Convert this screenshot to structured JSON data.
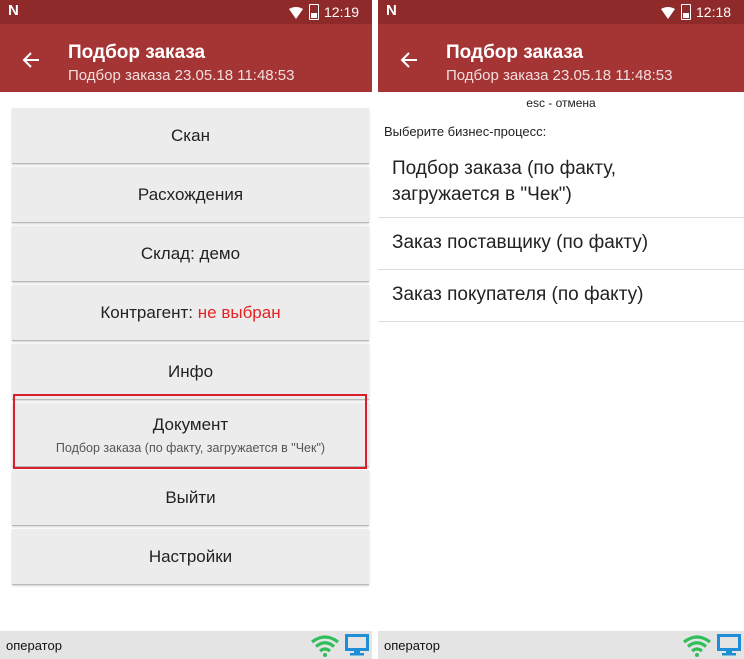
{
  "left": {
    "status_bar": {
      "time": "12:19"
    },
    "header": {
      "title": "Подбор заказа",
      "subtitle": "Подбор заказа 23.05.18 11:48:53"
    },
    "menu": {
      "scan": "Скан",
      "discrepancies": "Расхождения",
      "warehouse": "Склад: демо",
      "contractor_label": "Контрагент: ",
      "contractor_value": "не выбран",
      "info": "Инфо",
      "document_title": "Документ",
      "document_sub": "Подбор заказа (по факту, загружается в \"Чек\")",
      "exit": "Выйти",
      "settings": "Настройки"
    },
    "footer": {
      "operator": "оператор"
    }
  },
  "right": {
    "status_bar": {
      "time": "12:18"
    },
    "header": {
      "title": "Подбор заказа",
      "subtitle": "Подбор заказа 23.05.18 11:48:53"
    },
    "esc_hint": "esc - отмена",
    "prompt": "Выберите бизнес-процесс:",
    "processes": [
      "Подбор заказа (по факту, загружается в \"Чек\")",
      "Заказ поставщику (по факту)",
      "Заказ покупателя (по факту)"
    ],
    "footer": {
      "operator": "оператор"
    }
  },
  "colors": {
    "status_bar": "#8f2a2a",
    "app_bar": "#a53535",
    "accent_red": "#e52222",
    "highlight": "#d9202a",
    "wifi_green": "#2fbf5a",
    "monitor_blue": "#1e8fd6"
  },
  "icons": [
    "notification-n-icon",
    "wifi-icon",
    "battery-icon",
    "back-arrow-icon",
    "wifi-green-icon",
    "monitor-icon"
  ]
}
